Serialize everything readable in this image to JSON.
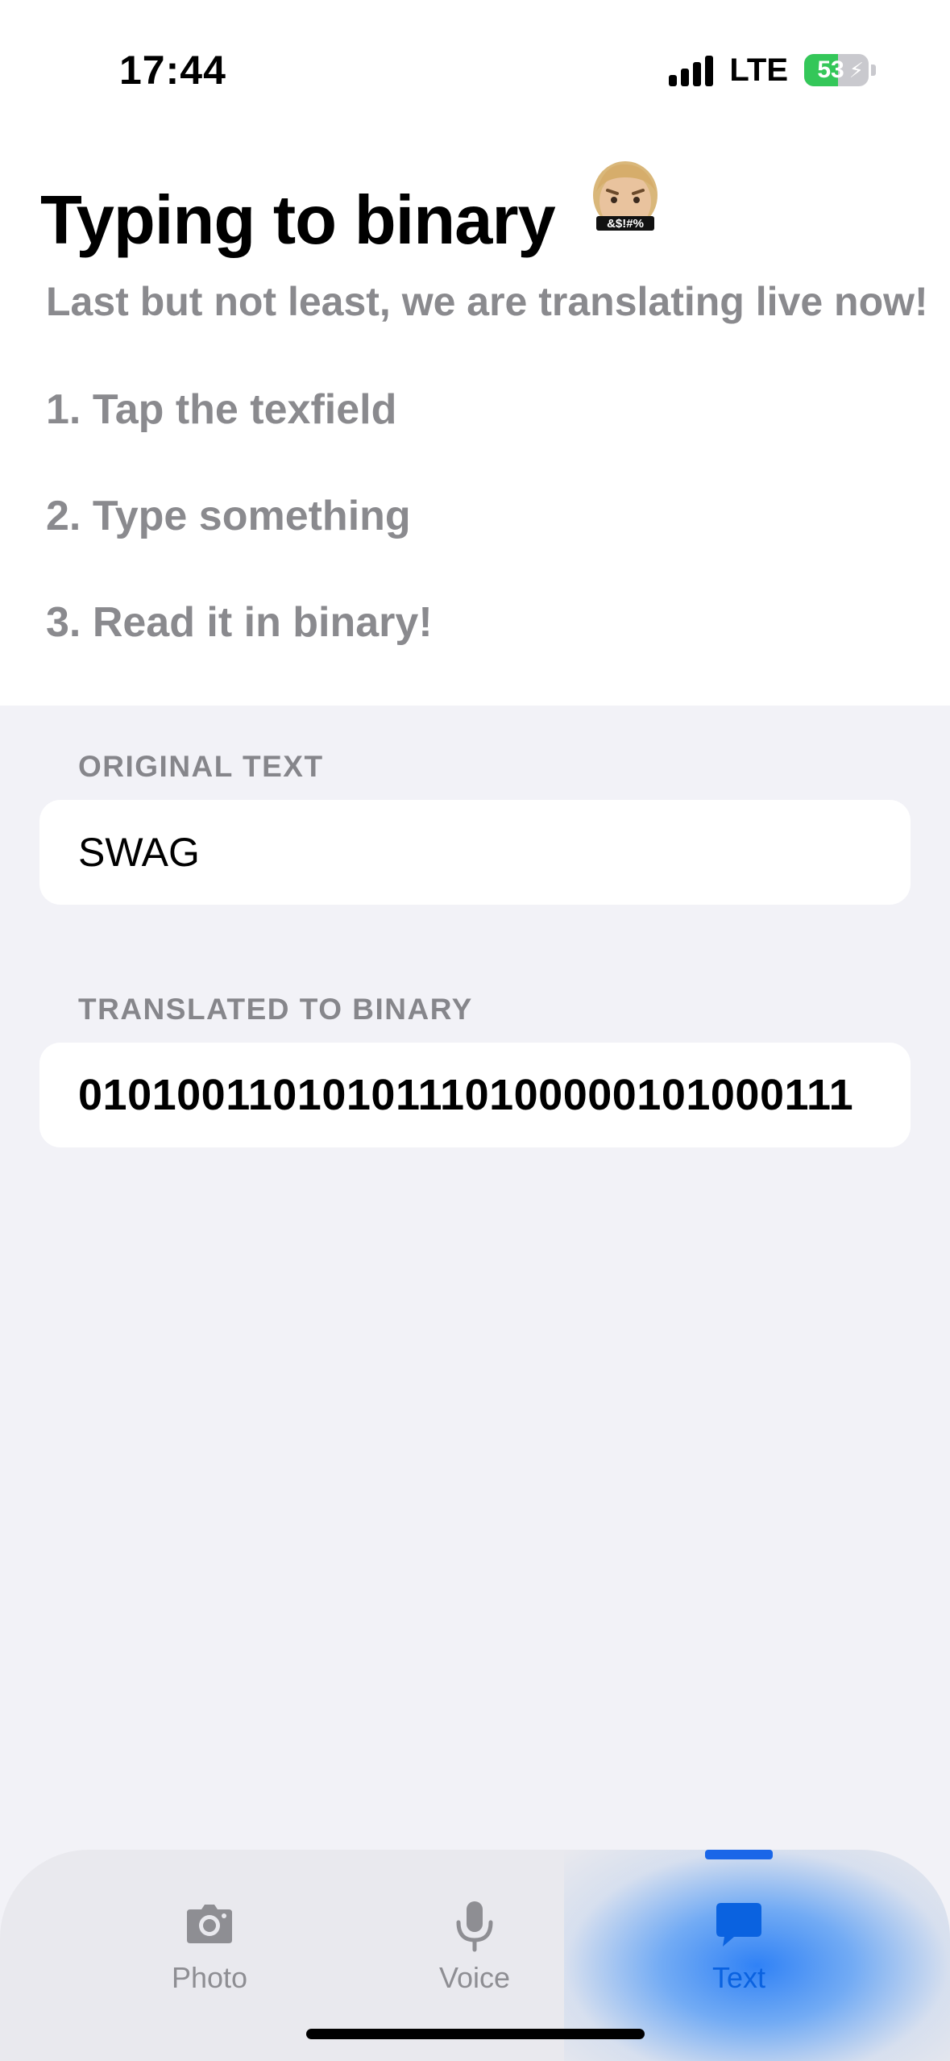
{
  "status_bar": {
    "time": "17:44",
    "network": "LTE",
    "battery_percent": "53",
    "battery_level": 0.53,
    "battery_color": "#34c759"
  },
  "header": {
    "title": "Typing to binary",
    "memoji_badge": "&$!#%",
    "subtitle": "Last but not least, we are translating live now!",
    "steps": [
      "1. Tap the texfield",
      "2. Type something",
      "3. Read it in binary!"
    ]
  },
  "form": {
    "original_label": "ORIGINAL TEXT",
    "original_value": "SWAG",
    "translated_label": "TRANSLATED TO BINARY",
    "translated_value": "01010011010101110100000101000111"
  },
  "tab_bar": {
    "accent": "#0a62e0",
    "tabs": [
      {
        "label": "Photo",
        "icon": "camera-icon",
        "active": false
      },
      {
        "label": "Voice",
        "icon": "microphone-icon",
        "active": false
      },
      {
        "label": "Text",
        "icon": "message-bubble-icon",
        "active": true
      }
    ]
  }
}
